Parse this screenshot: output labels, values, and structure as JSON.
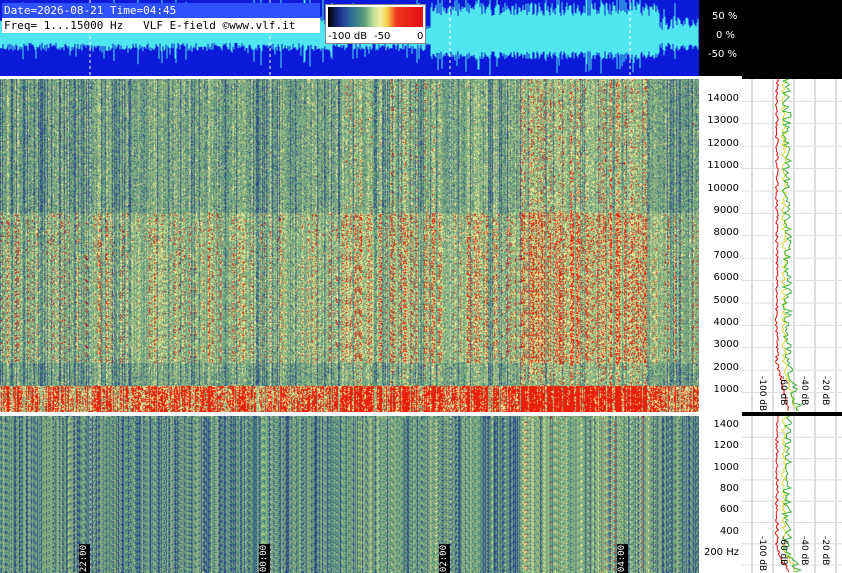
{
  "header": {
    "line1": "Date=2026-08-21 Time=04:45",
    "line2": "Freq= 1...15000 Hz   VLF E-field ©www.vlf.it"
  },
  "scale": {
    "labels": [
      "-100 dB",
      "-50",
      "0"
    ]
  },
  "waveform_pct": [
    "50 %",
    "0 %",
    "-50 %"
  ],
  "freq_axis_top": [
    "14000",
    "13000",
    "12000",
    "11000",
    "10000",
    "9000",
    "8000",
    "7000",
    "6000",
    "5000",
    "4000",
    "3000",
    "2000",
    "1000"
  ],
  "freq_axis_bottom": [
    "1400",
    "1200",
    "1000",
    "800",
    "600",
    "400",
    "200 Hz"
  ],
  "profile_db_labels": [
    "-100 dB",
    "-60 dB",
    "-40 dB",
    "-20 dB"
  ],
  "time_ticks": [
    "22:00",
    "00:00",
    "02:00",
    "04:00"
  ],
  "colors": {
    "waveform_bg": "#0a1ad8",
    "waveform_trace": "#4fe6f0",
    "header_highlight": "#2f52ff",
    "spectrum_red": "#e8200c",
    "spectrum_yellow": "#f3ec95",
    "spectrum_green": "#6f9f8a",
    "spectrum_blue": "#2a3f8e"
  }
}
